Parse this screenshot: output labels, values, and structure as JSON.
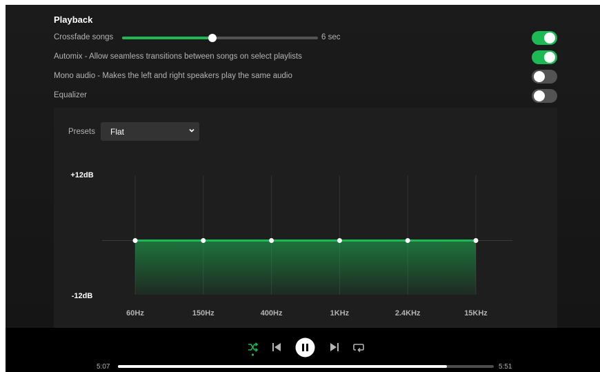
{
  "playback": {
    "title": "Playback",
    "crossfade": {
      "label": "Crossfade songs",
      "value_label": "6 sec",
      "level": 0.46,
      "enabled": true
    },
    "automix": {
      "label": "Automix - Allow seamless transitions between songs on select playlists",
      "enabled": true
    },
    "mono_audio": {
      "label": "Mono audio - Makes the left and right speakers play the same audio",
      "enabled": false
    },
    "equalizer": {
      "label": "Equalizer",
      "enabled": false
    }
  },
  "eq": {
    "presets_label": "Presets",
    "preset": "Flat",
    "db_max_label": "+12dB",
    "db_min_label": "-12dB",
    "db_range": [
      -12,
      12
    ],
    "bands": [
      {
        "label": "60Hz",
        "gain": 0
      },
      {
        "label": "150Hz",
        "gain": 0
      },
      {
        "label": "400Hz",
        "gain": 0
      },
      {
        "label": "1KHz",
        "gain": 0
      },
      {
        "label": "2.4KHz",
        "gain": 0
      },
      {
        "label": "15KHz",
        "gain": 0
      }
    ]
  },
  "player": {
    "elapsed": "5:07",
    "duration": "5:51",
    "progress": 0.875,
    "shuffle_active": true
  },
  "colors": {
    "accent": "#1db954",
    "background": "#121212",
    "panel": "#1e1e1e",
    "toggle_off": "#535353"
  }
}
